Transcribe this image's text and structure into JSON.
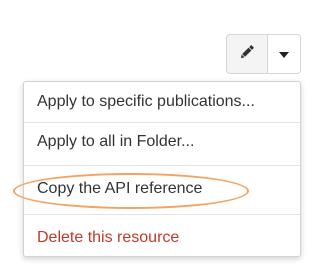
{
  "toolbar": {
    "edit_icon": "pencil-icon",
    "dropdown_icon": "caret-down-icon"
  },
  "menu": {
    "items": [
      {
        "label": "Apply to specific publications..."
      },
      {
        "label": "Apply to all in Folder..."
      },
      {
        "label": "Copy the API reference"
      },
      {
        "label": "Delete this resource"
      }
    ]
  },
  "colors": {
    "danger": "#c0392b",
    "highlight": "#f4a261",
    "text": "#333333"
  }
}
